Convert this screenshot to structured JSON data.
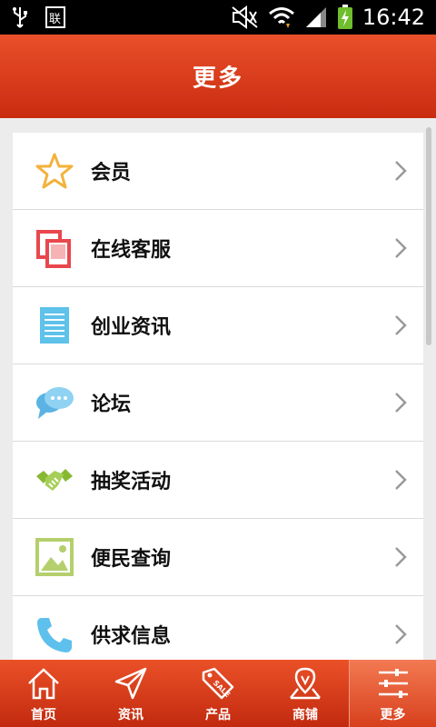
{
  "status_bar": {
    "time": "16:42"
  },
  "header": {
    "title": "更多"
  },
  "menu": [
    {
      "label": "会员",
      "icon": "star-icon"
    },
    {
      "label": "在线客服",
      "icon": "copy-window-icon"
    },
    {
      "label": "创业资讯",
      "icon": "document-lines-icon"
    },
    {
      "label": "论坛",
      "icon": "chat-bubbles-icon"
    },
    {
      "label": "抽奖活动",
      "icon": "handshake-icon"
    },
    {
      "label": "便民查询",
      "icon": "picture-icon"
    },
    {
      "label": "供求信息",
      "icon": "phone-icon"
    }
  ],
  "bottom_nav": [
    {
      "label": "首页",
      "icon": "home-icon"
    },
    {
      "label": "资讯",
      "icon": "paper-plane-icon"
    },
    {
      "label": "产品",
      "icon": "sale-tag-icon"
    },
    {
      "label": "商铺",
      "icon": "map-pin-icon"
    },
    {
      "label": "更多",
      "icon": "sliders-icon",
      "active": true
    }
  ],
  "colors": {
    "header": "#d83c1b",
    "accent_star": "#f3b23a",
    "service": "#e9474e",
    "doc": "#5ec2ea",
    "chat": "#78c6ee",
    "hand": "#86b832",
    "picture": "#b5cf6d",
    "phone": "#5ec0ec"
  }
}
